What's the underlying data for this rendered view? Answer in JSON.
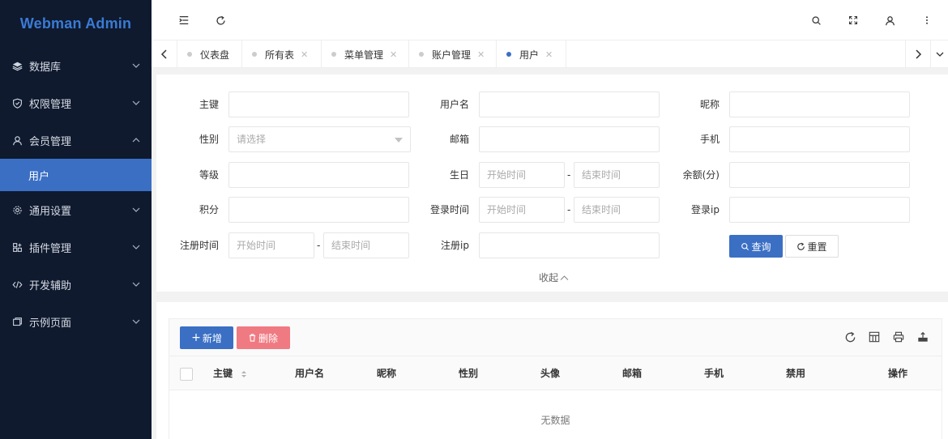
{
  "brand": {
    "title": "Webman Admin",
    "color": "#3a7bd5"
  },
  "sidebar": {
    "items": [
      {
        "label": "数据库",
        "icon": "layers-icon",
        "expanded": false
      },
      {
        "label": "权限管理",
        "icon": "shield-icon",
        "expanded": false
      },
      {
        "label": "会员管理",
        "icon": "user-icon",
        "expanded": true
      },
      {
        "label": "通用设置",
        "icon": "gear-icon",
        "expanded": false
      },
      {
        "label": "插件管理",
        "icon": "plugin-icon",
        "expanded": false
      },
      {
        "label": "开发辅助",
        "icon": "code-icon",
        "expanded": false
      },
      {
        "label": "示例页面",
        "icon": "page-icon",
        "expanded": false
      }
    ],
    "active_sub": {
      "label": "用户"
    }
  },
  "topbar": {
    "icons": [
      "menu-fold-icon",
      "refresh-icon",
      "search-icon",
      "fullscreen-icon",
      "user-icon",
      "more-icon"
    ]
  },
  "tabs": [
    {
      "label": "仪表盘",
      "closable": false,
      "active": false
    },
    {
      "label": "所有表",
      "closable": true,
      "active": false
    },
    {
      "label": "菜单管理",
      "closable": true,
      "active": false
    },
    {
      "label": "账户管理",
      "closable": true,
      "active": false
    },
    {
      "label": "用户",
      "closable": true,
      "active": true
    }
  ],
  "search": {
    "fields": {
      "id": "主键",
      "username": "用户名",
      "nickname": "昵称",
      "sex": "性别",
      "email": "邮箱",
      "mobile": "手机",
      "level": "等级",
      "birthday": "生日",
      "money": "余额(分)",
      "score": "积分",
      "last_time": "登录时间",
      "last_ip": "登录ip",
      "join_time": "注册时间",
      "join_ip": "注册ip"
    },
    "sex_placeholder": "请选择",
    "start_placeholder": "开始时间",
    "end_placeholder": "结束时间",
    "range_sep": "-",
    "query_label": "查询",
    "reset_label": "重置",
    "collapse_label": "收起"
  },
  "table": {
    "add_label": "新增",
    "delete_label": "删除",
    "columns": [
      "主键",
      "用户名",
      "昵称",
      "性别",
      "头像",
      "邮箱",
      "手机",
      "禁用",
      "操作"
    ],
    "empty_text": "无数据"
  },
  "colors": {
    "primary": "#3a6fc4",
    "danger": "#f07a82",
    "sidebar_bg": "#0f1a2e"
  }
}
